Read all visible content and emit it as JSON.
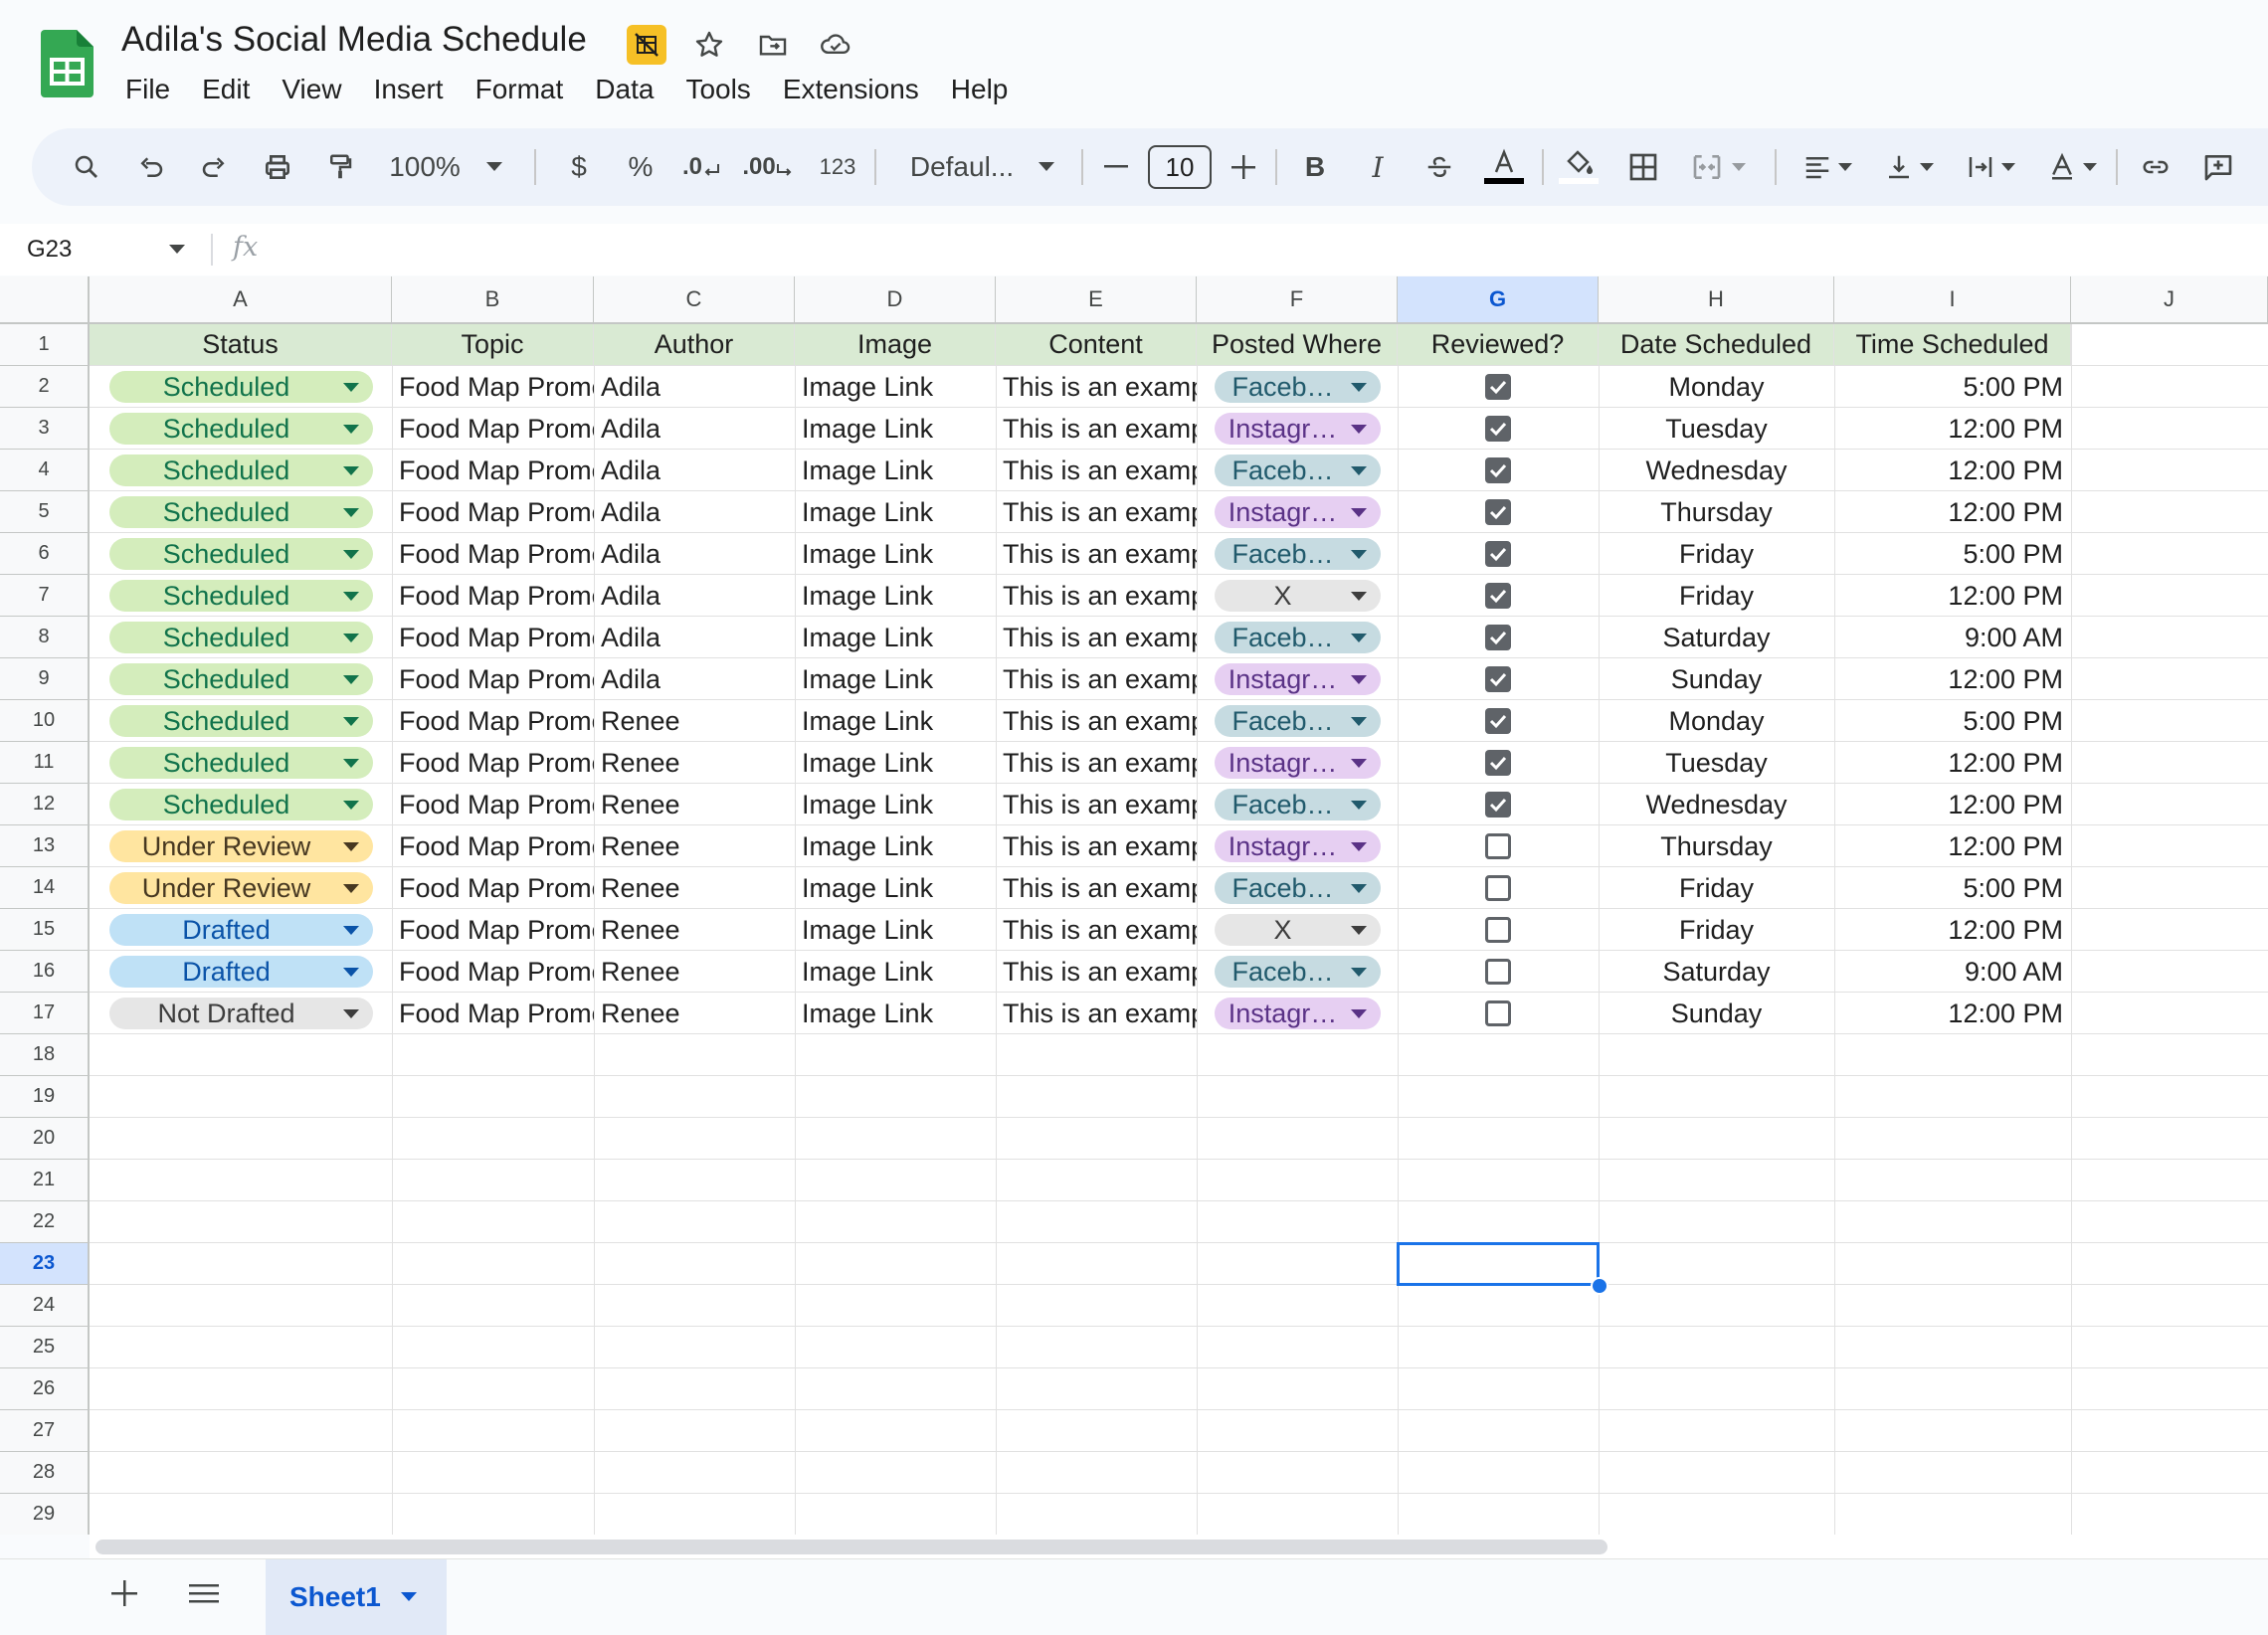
{
  "document": {
    "title": "Adila's Social Media Schedule"
  },
  "menu": [
    "File",
    "Edit",
    "View",
    "Insert",
    "Format",
    "Data",
    "Tools",
    "Extensions",
    "Help"
  ],
  "toolbar": {
    "zoom": "100%",
    "currency": "$",
    "percent": "%",
    "dec_minus": ".0",
    "dec_plus": ".00",
    "more_formats": "123",
    "font": "Defaul...",
    "font_size": "10",
    "bold": "B",
    "italic": "I"
  },
  "formula_bar": {
    "cell_ref": "G23",
    "fx": "fx"
  },
  "grid": {
    "columns": [
      "A",
      "B",
      "C",
      "D",
      "E",
      "F",
      "G",
      "H",
      "I",
      "J"
    ],
    "selected_column": "G",
    "selected_row": 23,
    "row_count": 29,
    "headers": [
      "Status",
      "Topic",
      "Author",
      "Image",
      "Content",
      "Posted Where",
      "Reviewed?",
      "Date Scheduled",
      "Time Scheduled"
    ],
    "rows": [
      {
        "status": "Scheduled",
        "topic": "Food Map Promo",
        "author": "Adila",
        "image": "Image Link",
        "content": "This is an example",
        "posted": "Faceb…",
        "reviewed": true,
        "date": "Monday",
        "time": "5:00 PM"
      },
      {
        "status": "Scheduled",
        "topic": "Food Map Promo",
        "author": "Adila",
        "image": "Image Link",
        "content": "This is an example",
        "posted": "Instagr…",
        "reviewed": true,
        "date": "Tuesday",
        "time": "12:00 PM"
      },
      {
        "status": "Scheduled",
        "topic": "Food Map Promo",
        "author": "Adila",
        "image": "Image Link",
        "content": "This is an example",
        "posted": "Faceb…",
        "reviewed": true,
        "date": "Wednesday",
        "time": "12:00 PM"
      },
      {
        "status": "Scheduled",
        "topic": "Food Map Promo",
        "author": "Adila",
        "image": "Image Link",
        "content": "This is an example",
        "posted": "Instagr…",
        "reviewed": true,
        "date": "Thursday",
        "time": "12:00 PM"
      },
      {
        "status": "Scheduled",
        "topic": "Food Map Promo",
        "author": "Adila",
        "image": "Image Link",
        "content": "This is an example",
        "posted": "Faceb…",
        "reviewed": true,
        "date": "Friday",
        "time": "5:00 PM"
      },
      {
        "status": "Scheduled",
        "topic": "Food Map Promo",
        "author": "Adila",
        "image": "Image Link",
        "content": "This is an example",
        "posted": "X",
        "reviewed": true,
        "date": "Friday",
        "time": "12:00 PM"
      },
      {
        "status": "Scheduled",
        "topic": "Food Map Promo",
        "author": "Adila",
        "image": "Image Link",
        "content": "This is an example",
        "posted": "Faceb…",
        "reviewed": true,
        "date": "Saturday",
        "time": "9:00 AM"
      },
      {
        "status": "Scheduled",
        "topic": "Food Map Promo",
        "author": "Adila",
        "image": "Image Link",
        "content": "This is an example",
        "posted": "Instagr…",
        "reviewed": true,
        "date": "Sunday",
        "time": "12:00 PM"
      },
      {
        "status": "Scheduled",
        "topic": "Food Map Promo",
        "author": "Renee",
        "image": "Image Link",
        "content": "This is an example",
        "posted": "Faceb…",
        "reviewed": true,
        "date": "Monday",
        "time": "5:00 PM"
      },
      {
        "status": "Scheduled",
        "topic": "Food Map Promo",
        "author": "Renee",
        "image": "Image Link",
        "content": "This is an example",
        "posted": "Instagr…",
        "reviewed": true,
        "date": "Tuesday",
        "time": "12:00 PM"
      },
      {
        "status": "Scheduled",
        "topic": "Food Map Promo",
        "author": "Renee",
        "image": "Image Link",
        "content": "This is an example",
        "posted": "Faceb…",
        "reviewed": true,
        "date": "Wednesday",
        "time": "12:00 PM"
      },
      {
        "status": "Under Review",
        "topic": "Food Map Promo",
        "author": "Renee",
        "image": "Image Link",
        "content": "This is an example",
        "posted": "Instagr…",
        "reviewed": false,
        "date": "Thursday",
        "time": "12:00 PM"
      },
      {
        "status": "Under Review",
        "topic": "Food Map Promo",
        "author": "Renee",
        "image": "Image Link",
        "content": "This is an example",
        "posted": "Faceb…",
        "reviewed": false,
        "date": "Friday",
        "time": "5:00 PM"
      },
      {
        "status": "Drafted",
        "topic": "Food Map Promo",
        "author": "Renee",
        "image": "Image Link",
        "content": "This is an example",
        "posted": "X",
        "reviewed": false,
        "date": "Friday",
        "time": "12:00 PM"
      },
      {
        "status": "Drafted",
        "topic": "Food Map Promo",
        "author": "Renee",
        "image": "Image Link",
        "content": "This is an example",
        "posted": "Faceb…",
        "reviewed": false,
        "date": "Saturday",
        "time": "9:00 AM"
      },
      {
        "status": "Not Drafted",
        "topic": "Food Map Promo",
        "author": "Renee",
        "image": "Image Link",
        "content": "This is an example",
        "posted": "Instagr…",
        "reviewed": false,
        "date": "Sunday",
        "time": "12:00 PM"
      }
    ]
  },
  "chip_colors": {
    "Scheduled": {
      "bg": "#d4edbc",
      "fg": "#11734b"
    },
    "Under Review": {
      "bg": "#ffe5a0",
      "fg": "#473821"
    },
    "Drafted": {
      "bg": "#bfe1f6",
      "fg": "#0a53a8"
    },
    "Not Drafted": {
      "bg": "#e6e6e6",
      "fg": "#3d3d3d"
    },
    "Faceb…": {
      "bg": "#c6dbe1",
      "fg": "#215a6c"
    },
    "Instagr…": {
      "bg": "#e6cff2",
      "fg": "#5a3286"
    },
    "X": {
      "bg": "#e6e6e6",
      "fg": "#3d3d3d"
    }
  },
  "sheets": {
    "active": "Sheet1"
  }
}
